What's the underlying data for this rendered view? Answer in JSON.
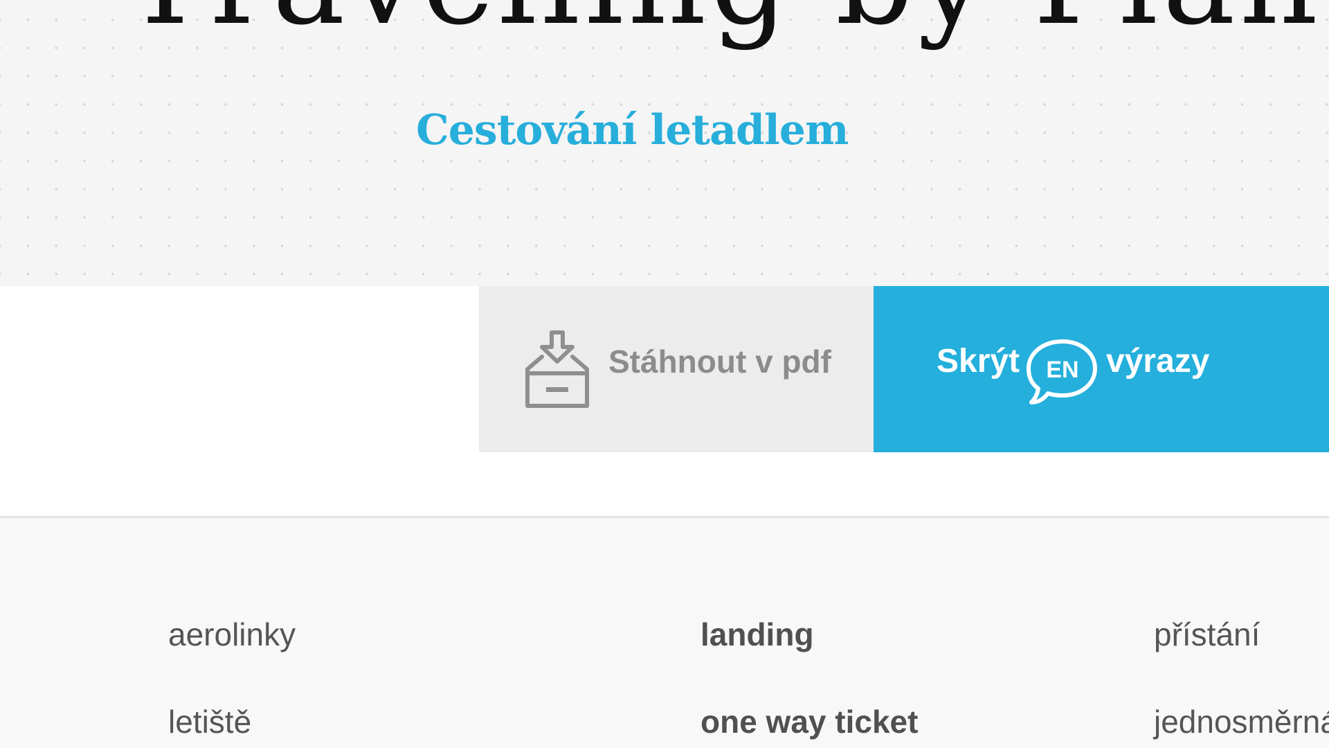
{
  "hero": {
    "title": "Travelling by Plane",
    "subtitle": "Cestování letadlem"
  },
  "actions": {
    "download_label": "Stáhnout v pdf",
    "toggle_word_1": "Skrýt",
    "toggle_badge": "EN",
    "toggle_word_2": "výrazy"
  },
  "vocabulary": [
    {
      "term_cs": "aerolinky",
      "term_en": "landing",
      "translation_cs": "přístání"
    },
    {
      "term_cs": "letiště",
      "term_en": "one way ticket",
      "translation_cs": "jednosměrná"
    }
  ],
  "colors": {
    "accent": "#24afdc",
    "subtitle": "#27aedb",
    "download_bg": "#ececec",
    "download_text": "#8c8c8c"
  },
  "icons": {
    "download": "archive-download-icon",
    "language": "en-speech-bubble-icon"
  }
}
